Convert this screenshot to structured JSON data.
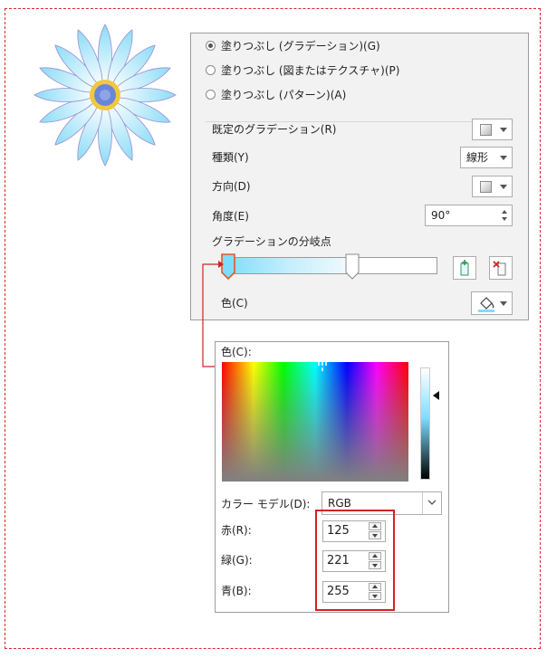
{
  "fill_options": [
    {
      "label": "塗りつぶし (グラデーション)(G)",
      "selected": true
    },
    {
      "label": "塗りつぶし (図またはテクスチャ)(P)",
      "selected": false
    },
    {
      "label": "塗りつぶし (パターン)(A)",
      "selected": false
    }
  ],
  "preset_label": "既定のグラデーション(R)",
  "type_label": "種類(Y)",
  "type_value": "線形",
  "direction_label": "方向(D)",
  "angle_label": "角度(E)",
  "angle_value": "90°",
  "stops_label": "グラデーションの分岐点",
  "color_label": "色(C)",
  "picker": {
    "title": "色(C):",
    "model_label": "カラー モデル(D):",
    "model_value": "RGB",
    "red_label": "赤(R):",
    "red_value": "125",
    "green_label": "緑(G):",
    "green_value": "221",
    "blue_label": "青(B):",
    "blue_value": "255"
  },
  "colors": {
    "highlight": "#d42222",
    "stop_color": "#7dddff",
    "accent": "#e05a2a"
  },
  "icons": [
    "flower-illustration",
    "add-stop-icon",
    "remove-stop-icon",
    "paint-bucket-icon",
    "chevron-down-icon"
  ]
}
